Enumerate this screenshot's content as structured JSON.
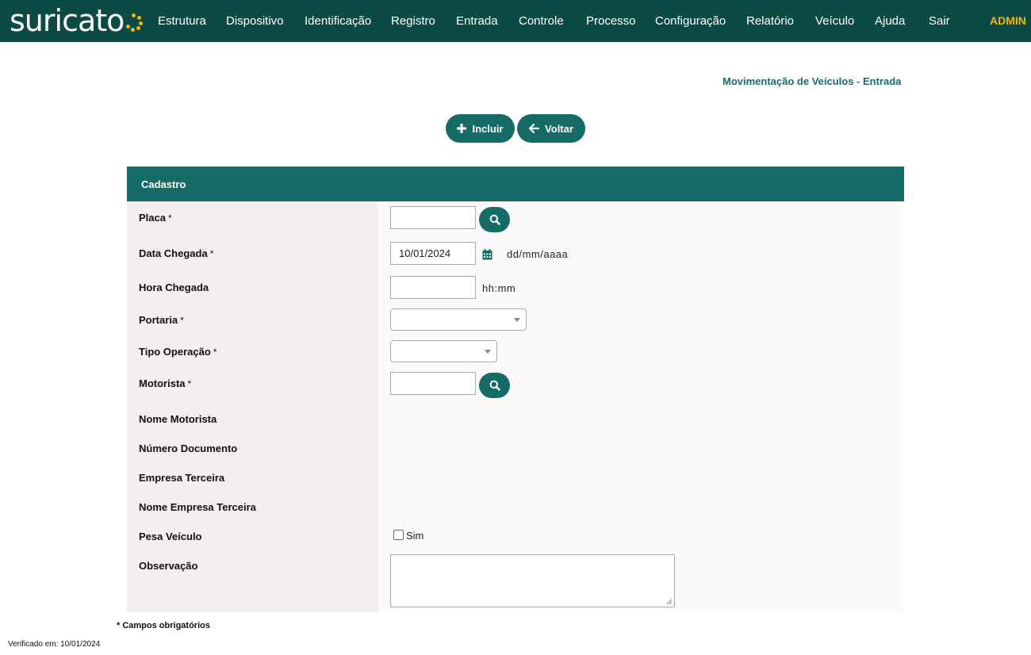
{
  "header": {
    "logo_text": "suricato",
    "nav": [
      "Estrutura",
      "Dispositivo",
      "Identificação",
      "Registro",
      "Entrada",
      "Controle",
      "Processo",
      "Configuração",
      "Relatório",
      "Veículo",
      "Ajuda",
      "Sair"
    ],
    "user": "ADMIN"
  },
  "page": {
    "title": "Movimentação de Veículos - Entrada",
    "include_label": "Incluir",
    "back_label": "Voltar"
  },
  "form": {
    "section_title": "Cadastro",
    "required_mark": "*",
    "fields": {
      "placa": {
        "label": "Placa",
        "value": ""
      },
      "data_chegada": {
        "label": "Data Chegada",
        "value": "10/01/2024",
        "hint": "dd/mm/aaaa"
      },
      "hora_chegada": {
        "label": "Hora Chegada",
        "value": "",
        "hint": "hh:mm"
      },
      "portaria": {
        "label": "Portaria",
        "value": ""
      },
      "tipo_operacao": {
        "label": "Tipo Operação",
        "value": ""
      },
      "motorista": {
        "label": "Motorista",
        "value": ""
      },
      "nome_motorista": {
        "label": "Nome Motorista"
      },
      "numero_documento": {
        "label": "Número Documento"
      },
      "empresa_terceira": {
        "label": "Empresa Terceira"
      },
      "nome_empresa_terceira": {
        "label": "Nome Empresa Terceira"
      },
      "pesa_veiculo": {
        "label": "Pesa Veículo",
        "option": "Sim",
        "checked": false
      },
      "observacao": {
        "label": "Observação",
        "value": ""
      }
    }
  },
  "footer": {
    "required_note": "* Campos obrigatórios",
    "verified": "Verificado em: 10/01/2024"
  },
  "colors": {
    "topbar": "#0c4a45",
    "primary": "#166b67",
    "accent": "#f2b705",
    "title_text": "#1a6b67"
  }
}
